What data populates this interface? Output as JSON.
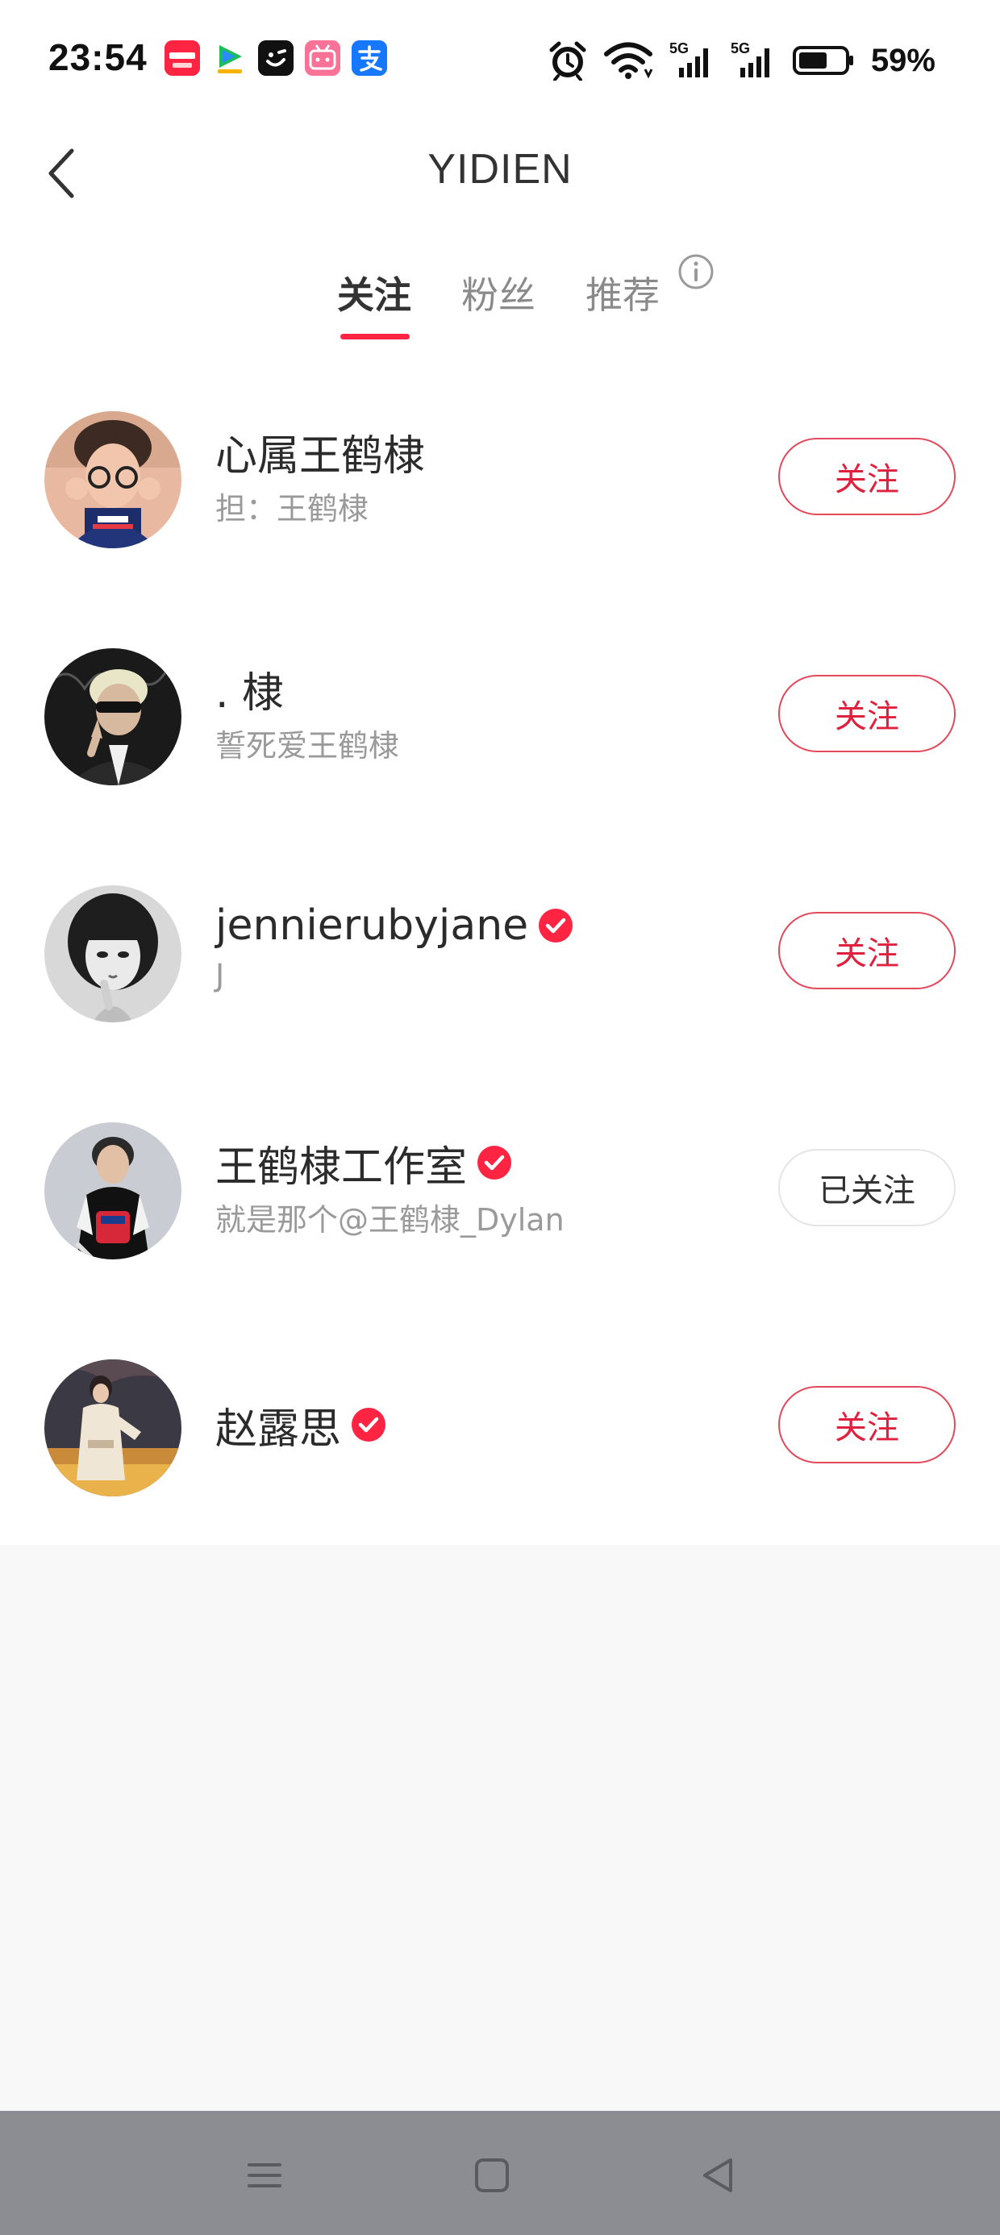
{
  "status_bar": {
    "time": "23:54",
    "battery": "59%",
    "notification_apps": [
      "xiaohongshu-app-icon",
      "tencent-video-app-icon",
      "smile-app-icon",
      "bilibili-app-icon",
      "alipay-app-icon"
    ],
    "system_icons": [
      "alarm-icon",
      "wifi-icon",
      "signal-5g-icon",
      "signal-5g-icon",
      "battery-icon"
    ]
  },
  "header": {
    "title": "YIDIEN",
    "tabs": [
      {
        "label": "关注",
        "active": true
      },
      {
        "label": "粉丝",
        "active": false
      },
      {
        "label": "推荐",
        "active": false
      }
    ]
  },
  "users": [
    {
      "name": "心属王鹤棣",
      "desc": "担：王鹤棣",
      "verified": false,
      "button": "关注",
      "followed": false
    },
    {
      "name": ". 棣",
      "desc": "誓死爱王鹤棣",
      "verified": false,
      "button": "关注",
      "followed": false
    },
    {
      "name": "jennierubyjane",
      "desc": "J",
      "verified": true,
      "button": "关注",
      "followed": false
    },
    {
      "name": "王鹤棣工作室",
      "desc": "就是那个@王鹤棣_Dylan",
      "verified": true,
      "button": "已关注",
      "followed": true
    },
    {
      "name": "赵露思",
      "desc": "",
      "verified": true,
      "button": "关注",
      "followed": false
    }
  ],
  "colors": {
    "accent": "#ff2442",
    "follow_text": "#e0213d",
    "nav_bar": "#8c8d92"
  },
  "nav_bar": {
    "buttons": [
      "menu-icon",
      "home-square-icon",
      "back-triangle-icon"
    ]
  }
}
